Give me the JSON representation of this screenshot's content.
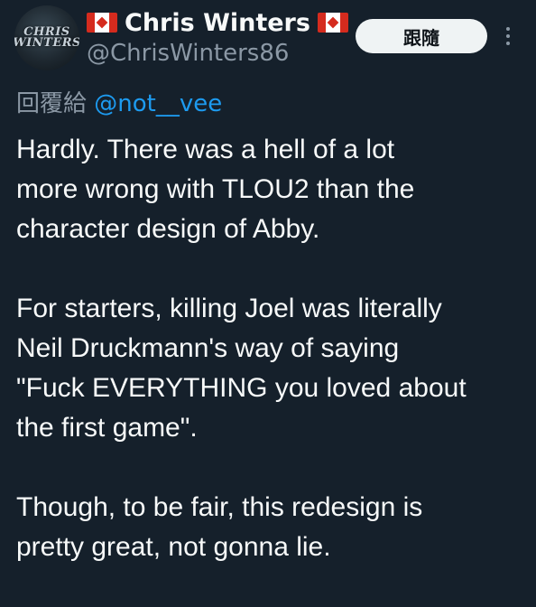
{
  "author": {
    "display_name": "Chris Winters",
    "handle": "@ChrisWinters86",
    "avatar_text": [
      "CHRIS",
      "WINTERS"
    ]
  },
  "follow_button": {
    "label": "跟隨"
  },
  "reply_context": {
    "prefix": "回覆給",
    "mention": "@not__vee"
  },
  "tweet": {
    "paragraphs": [
      {
        "lines": [
          "Hardly. There was a hell of a lot",
          "more wrong with TLOU2 than the",
          "character design of Abby."
        ]
      },
      {
        "lines": [
          "For starters, killing Joel was literally",
          "Neil Druckmann's way of saying",
          "\"Fuck EVERYTHING you loved about",
          "the first game\"."
        ]
      },
      {
        "lines": [
          "Though, to be fair, this redesign is",
          "pretty great, not gonna lie."
        ]
      }
    ]
  },
  "colors": {
    "background": "#15202b",
    "text_primary": "#f7f9f9",
    "text_secondary": "#8b98a5",
    "accent": "#1d9bf0",
    "follow_button_bg": "#eff3f4"
  },
  "icons": {
    "flag": "canada-flag-icon",
    "more": "more-dots-icon"
  }
}
